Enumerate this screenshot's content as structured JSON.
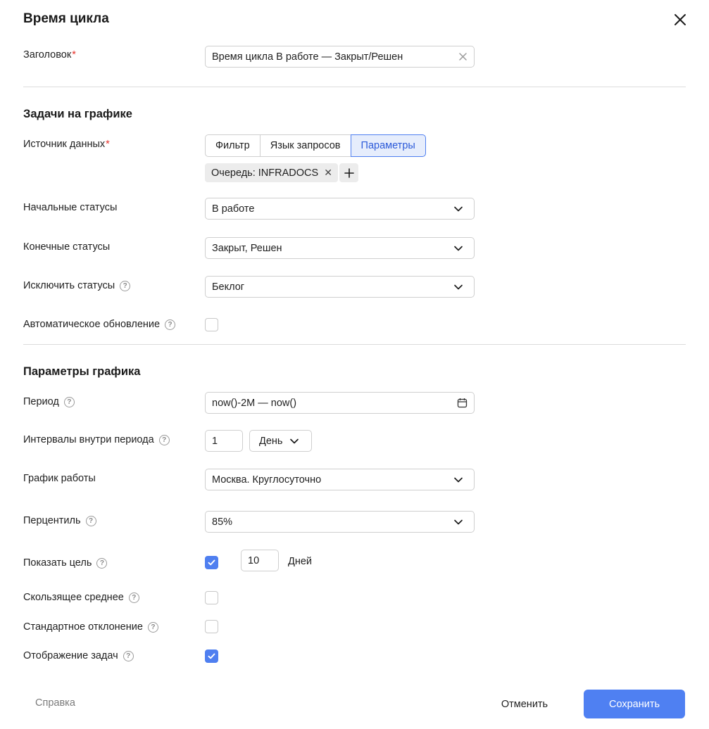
{
  "dialog": {
    "title": "Время цикла"
  },
  "heading_field": {
    "label": "Заголовок",
    "value": "Время цикла В работе — Закрыт/Решен"
  },
  "tasks_section": {
    "title": "Задачи на графике",
    "source": {
      "label": "Источник данных",
      "tabs": [
        "Фильтр",
        "Язык запросов",
        "Параметры"
      ],
      "active_tab": "Параметры"
    },
    "chip": "Очередь: INFRADOCS",
    "start_statuses": {
      "label": "Начальные статусы",
      "value": "В работе"
    },
    "end_statuses": {
      "label": "Конечные статусы",
      "value": "Закрыт, Решен"
    },
    "exclude_statuses": {
      "label": "Исключить статусы",
      "value": "Беклог"
    },
    "auto_update": {
      "label": "Автоматическое обновление",
      "checked": false
    }
  },
  "chart_section": {
    "title": "Параметры графика",
    "period": {
      "label": "Период",
      "value": "now()-2M — now()"
    },
    "intervals": {
      "label": "Интервалы внутри периода",
      "count": "1",
      "unit": "День"
    },
    "schedule": {
      "label": "График работы",
      "value": "Москва. Круглосуточно"
    },
    "percentile": {
      "label": "Перцентиль",
      "value": "85%"
    },
    "goal": {
      "label": "Показать цель",
      "checked": true,
      "value": "10",
      "unit": "Дней"
    },
    "moving_average": {
      "label": "Скользящее среднее",
      "checked": false
    },
    "std_dev": {
      "label": "Стандартное отклонение",
      "checked": false
    },
    "show_tasks": {
      "label": "Отображение задач",
      "checked": true
    }
  },
  "footer": {
    "help": "Справка",
    "cancel": "Отменить",
    "save": "Сохранить"
  },
  "colors": {
    "accent": "#4f80f2",
    "required": "#e5312a",
    "active_tab_bg": "#e6edfc"
  }
}
